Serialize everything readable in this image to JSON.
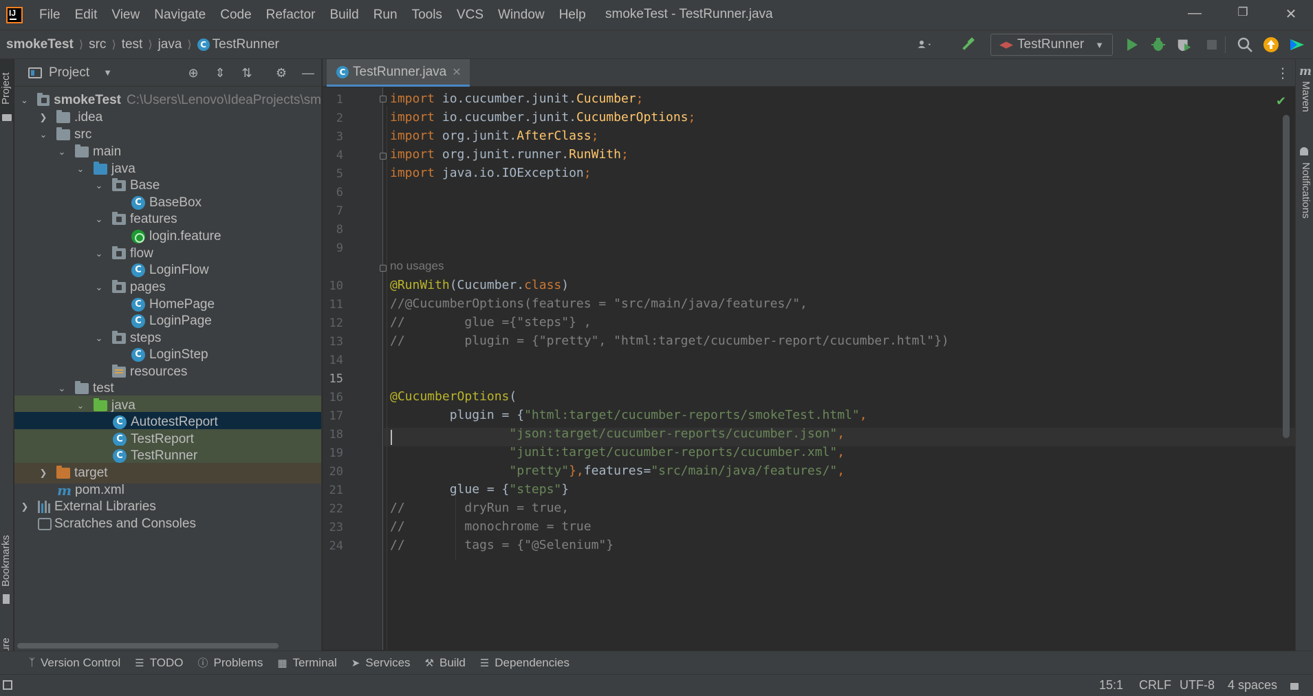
{
  "menu": {
    "items": [
      "File",
      "Edit",
      "View",
      "Navigate",
      "Code",
      "Refactor",
      "Build",
      "Run",
      "Tools",
      "VCS",
      "Window",
      "Help"
    ],
    "window_title": "smokeTest - TestRunner.java"
  },
  "breadcrumb": {
    "items": [
      "smokeTest",
      "src",
      "test",
      "java",
      "TestRunner"
    ]
  },
  "toolbar": {
    "run_config": "TestRunner"
  },
  "left_stripe": {
    "project": "Project",
    "bookmarks": "Bookmarks",
    "structure": "Structure"
  },
  "right_stripe": {
    "maven": "Maven",
    "notifications": "Notifications"
  },
  "project_panel": {
    "title": "Project",
    "tree": [
      {
        "label": "smokeTest",
        "path": "C:\\Users\\Lenovo\\IdeaProjects\\sm"
      },
      {
        "label": ".idea"
      },
      {
        "label": "src"
      },
      {
        "label": "main"
      },
      {
        "label": "java"
      },
      {
        "label": "Base"
      },
      {
        "label": "BaseBox"
      },
      {
        "label": "features"
      },
      {
        "label": "login.feature"
      },
      {
        "label": "flow"
      },
      {
        "label": "LoginFlow"
      },
      {
        "label": "pages"
      },
      {
        "label": "HomePage"
      },
      {
        "label": "LoginPage"
      },
      {
        "label": "steps"
      },
      {
        "label": "LoginStep"
      },
      {
        "label": "resources"
      },
      {
        "label": "test"
      },
      {
        "label": "java"
      },
      {
        "label": "AutotestReport"
      },
      {
        "label": "TestReport"
      },
      {
        "label": "TestRunner"
      },
      {
        "label": "target"
      },
      {
        "label": "pom.xml"
      },
      {
        "label": "External Libraries"
      },
      {
        "label": "Scratches and Consoles"
      }
    ]
  },
  "editor": {
    "tab": "TestRunner.java",
    "usage_hint": "no usages",
    "line_numbers": [
      "1",
      "2",
      "3",
      "4",
      "5",
      "6",
      "7",
      "8",
      "9",
      "10",
      "11",
      "12",
      "13",
      "14",
      "15",
      "16",
      "17",
      "18",
      "19",
      "20",
      "21",
      "22",
      "23",
      "24"
    ],
    "code": {
      "l1a": "import",
      "l1b": " io.cucumber.junit.",
      "l1c": "Cucumber",
      "l1d": ";",
      "l2a": "import",
      "l2b": " io.cucumber.junit.",
      "l2c": "CucumberOptions",
      "l2d": ";",
      "l3a": "import",
      "l3b": " org.junit.",
      "l3c": "AfterClass",
      "l3d": ";",
      "l4a": "import",
      "l4b": " org.junit.runner.",
      "l4c": "RunWith",
      "l4d": ";",
      "l5a": "import",
      "l5b": " java.io.IOException",
      "l5d": ";",
      "l10a": "@RunWith",
      "l10b": "(Cucumber.",
      "l10c": "class",
      "l10d": ")",
      "l11": "//@CucumberOptions(features = \"src/main/java/features/\",",
      "l12": "//        glue ={\"steps\"} ,",
      "l13": "//        plugin = {\"pretty\", \"html:target/cucumber-report/cucumber.html\"})",
      "l16a": "@CucumberOptions",
      "l16b": "(",
      "l17a": "        plugin = {",
      "l17b": "\"html:target/cucumber-reports/smokeTest.html\"",
      "l17c": ",",
      "l18a": "                ",
      "l18b": "\"json:target/cucumber-reports/cucumber.json\"",
      "l18c": ",",
      "l19a": "                ",
      "l19b": "\"junit:target/cucumber-reports/cucumber.xml\"",
      "l19c": ",",
      "l20a": "                ",
      "l20b": "\"pretty\"",
      "l20c": "},",
      "l20d": "features=",
      "l20e": "\"src/main/java/features/\"",
      "l20f": ",",
      "l21a": "        glue = {",
      "l21b": "\"steps\"",
      "l21c": "}",
      "l22": "//        dryRun = true,",
      "l23": "//        monochrome = true",
      "l24": "//        tags = {\"@Selenium\"}"
    }
  },
  "bottom_tools": [
    "Version Control",
    "TODO",
    "Problems",
    "Terminal",
    "Services",
    "Build",
    "Dependencies"
  ],
  "status": {
    "position": "15:1",
    "line_sep": "CRLF",
    "encoding": "UTF-8",
    "indent": "4 spaces"
  }
}
